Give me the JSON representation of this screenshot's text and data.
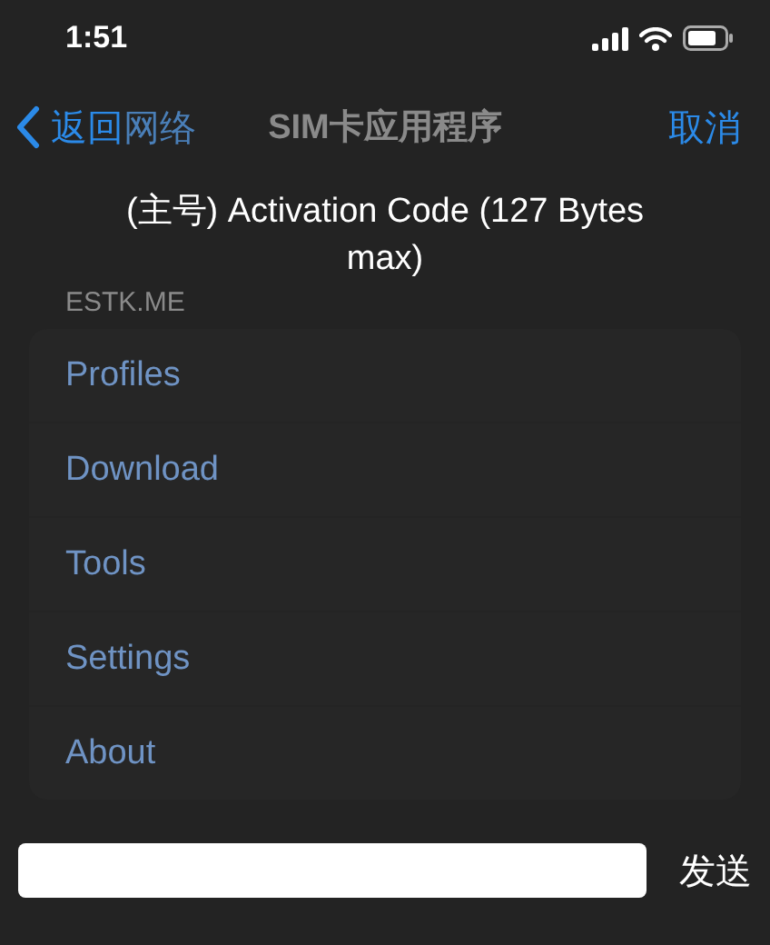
{
  "status_bar": {
    "time": "1:51"
  },
  "nav": {
    "back_label": "返回",
    "back_title": "网络",
    "title": "SIM卡应用程序",
    "cancel": "取消"
  },
  "menu": {
    "header": "ESTK.ME",
    "items": [
      "Profiles",
      "Download",
      "Tools",
      "Settings",
      "About"
    ]
  },
  "prompt": {
    "title": "(主号) Activation Code (127 Bytes max)",
    "send": "发送"
  }
}
